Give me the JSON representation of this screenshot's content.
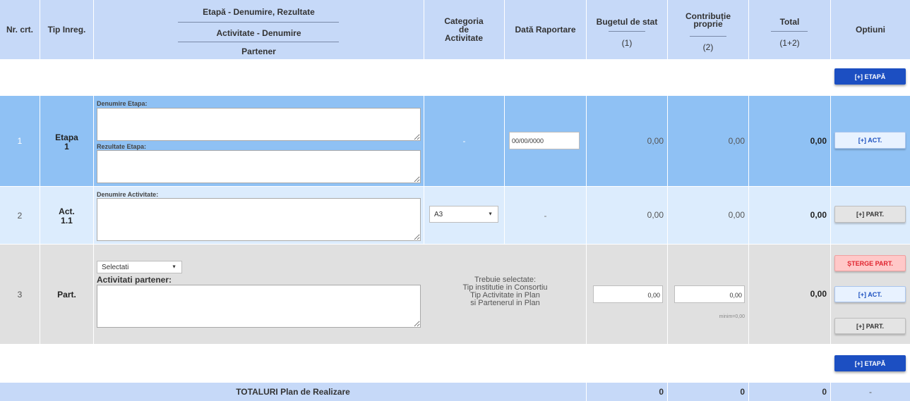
{
  "header": {
    "nr_crt": "Nr. crt.",
    "tip_inreg": "Tip Inreg.",
    "col3_line1": "Etapă - Denumire, Rezultate",
    "col3_line2": "Activitate - Denumire",
    "col3_line3": "Partener",
    "categoria": "Categoria de Activitate",
    "data_raportare": "Dată Raportare",
    "buget_top": "Bugetul de stat",
    "buget_bottom": "(1)",
    "contrib_top": "Contribuție proprie",
    "contrib_bottom": "(2)",
    "total_top": "Total",
    "total_bottom": "(1+2)",
    "optiuni": "Optiuni"
  },
  "buttons": {
    "add_etapa": "[+] ETAPĂ",
    "add_act": "[+] ACT.",
    "add_part": "[+] PART.",
    "sterge_part": "ȘTERGE PART."
  },
  "rows": [
    {
      "nr": "1",
      "tip_line1": "Etapa",
      "tip_line2": "1",
      "label_denumire": "Denumire Etapa:",
      "label_rezultate": "Rezultate Etapa:",
      "categoria": "-",
      "data_value": "00/00/0000",
      "buget": "0,00",
      "contrib": "0,00",
      "total": "0,00"
    },
    {
      "nr": "2",
      "tip_line1": "Act.",
      "tip_line2": "1.1",
      "label_denumire": "Denumire Activitate:",
      "categoria_select": "A3",
      "data": "-",
      "buget": "0,00",
      "contrib": "0,00",
      "total": "0,00"
    },
    {
      "nr": "3",
      "tip": "Part.",
      "partener_select": "Selectati",
      "label_activitati": "Activitati partener:",
      "info_lines": [
        "Trebuie selectate:",
        "Tip institutie in Consortiu",
        "Tip Activitate in Plan",
        "si Partenerul in Plan"
      ],
      "buget_value": "0,00",
      "contrib_value": "0,00",
      "contrib_min": "minim=0,00",
      "total": "0,00"
    }
  ],
  "totals": {
    "label": "TOTALURI Plan de Realizare",
    "buget": "0",
    "contrib": "0",
    "total": "0",
    "optiuni": "-"
  },
  "colors": {
    "header_bg": "#c6d9f8",
    "etapa_row_bg": "#8fc1f4",
    "act_row_bg": "#dcecfd",
    "part_row_bg": "#e0e0e0",
    "primary_button": "#1c4fc2",
    "danger_text": "#e0232e"
  }
}
